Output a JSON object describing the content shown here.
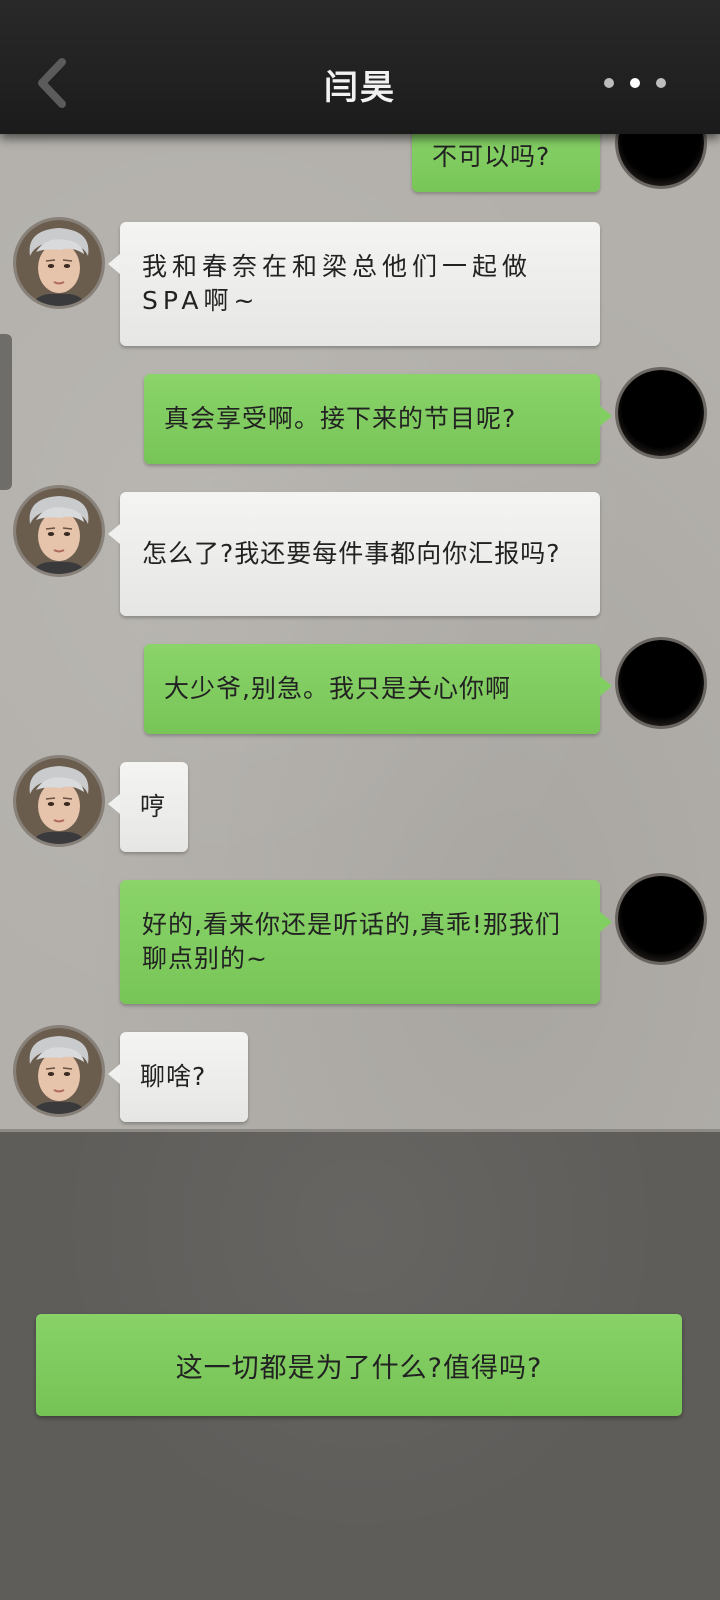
{
  "header": {
    "title": "闫昊",
    "back_icon": "chevron-left-icon",
    "more_icon": "more-horizontal-icon"
  },
  "messages": [
    {
      "side": "right",
      "text": "不可以吗?"
    },
    {
      "side": "left",
      "text": "我和春奈在和梁总他们一起做SPA啊~"
    },
    {
      "side": "right",
      "text": "真会享受啊。接下来的节目呢?"
    },
    {
      "side": "left",
      "text": "怎么了?我还要每件事都向你汇报吗?"
    },
    {
      "side": "right",
      "text": "大少爷,别急。我只是关心你啊"
    },
    {
      "side": "left",
      "text": "哼"
    },
    {
      "side": "right",
      "text": "好的,看来你还是听话的,真乖!那我们聊点别的~"
    },
    {
      "side": "left",
      "text": "聊啥?"
    }
  ],
  "reply_option": {
    "text": "这一切都是为了什么?值得吗?"
  },
  "colors": {
    "header_bg": "#222121",
    "chat_bg": "#b3b0ab",
    "bottom_bg": "#5f5d5a",
    "bubble_left": "#eeeeec",
    "bubble_right": "#80cc5f"
  }
}
